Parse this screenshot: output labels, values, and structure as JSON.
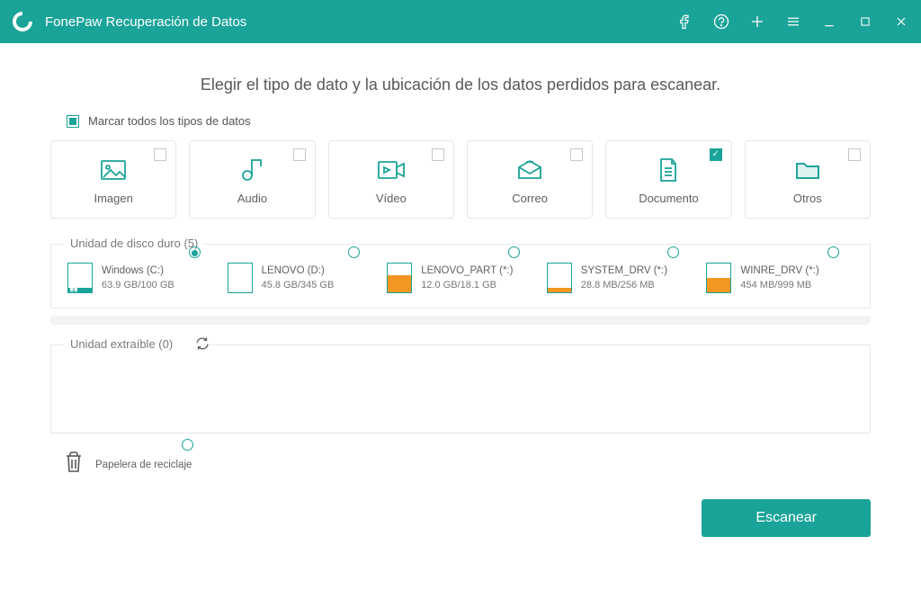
{
  "app": {
    "title": "FonePaw Recuperación de Datos"
  },
  "heading": "Elegir el tipo de dato y la ubicación de los datos perdidos para escanear.",
  "selectAll": "Marcar todos los tipos de datos",
  "types": [
    {
      "id": "imagen",
      "label": "Imagen",
      "checked": false
    },
    {
      "id": "audio",
      "label": "Audio",
      "checked": false
    },
    {
      "id": "video",
      "label": "Vídeo",
      "checked": false
    },
    {
      "id": "correo",
      "label": "Correo",
      "checked": false
    },
    {
      "id": "documento",
      "label": "Documento",
      "checked": true
    },
    {
      "id": "otros",
      "label": "Otros",
      "checked": false
    }
  ],
  "hddLegend": "Unidad de disco duro (5)",
  "drives": [
    {
      "name": "Windows (C:)",
      "size": "63.9 GB/100 GB",
      "fillPct": 15,
      "selected": true,
      "windows": true,
      "fillColor": "#1aa398"
    },
    {
      "name": "LENOVO (D:)",
      "size": "45.8 GB/345 GB",
      "fillPct": 0,
      "selected": false,
      "windows": false,
      "fillColor": "#f49721"
    },
    {
      "name": "LENOVO_PART (*:)",
      "size": "12.0 GB/18.1 GB",
      "fillPct": 60,
      "selected": false,
      "windows": false,
      "fillColor": "#f49721"
    },
    {
      "name": "SYSTEM_DRV (*:)",
      "size": "28.8 MB/256 MB",
      "fillPct": 15,
      "selected": false,
      "windows": false,
      "fillColor": "#f49721"
    },
    {
      "name": "WINRE_DRV (*:)",
      "size": "454 MB/999 MB",
      "fillPct": 50,
      "selected": false,
      "windows": false,
      "fillColor": "#f49721"
    }
  ],
  "removableLegend": "Unidad extraíble (0)",
  "recycle": "Papelera de reciclaje",
  "scan": "Escanear",
  "colors": {
    "accent": "#1aa398",
    "orange": "#f49721"
  }
}
